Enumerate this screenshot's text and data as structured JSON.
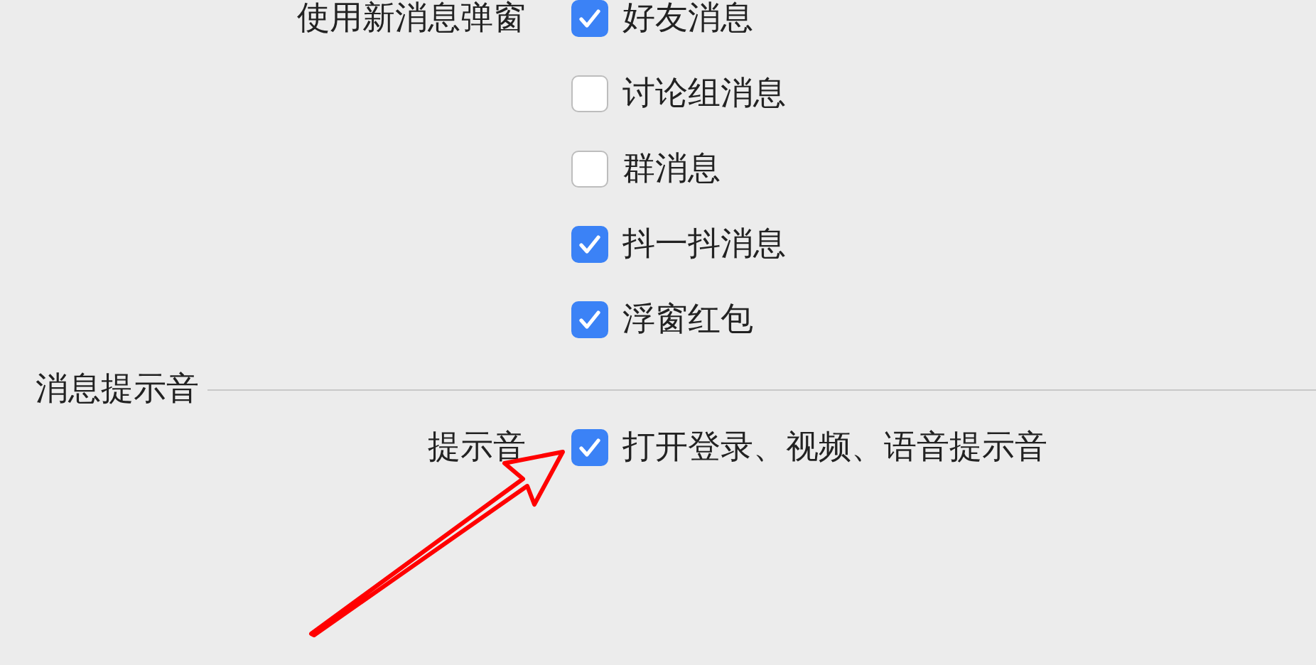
{
  "sections": [
    {
      "rows": [
        {
          "label": "使用新消息弹窗",
          "options": [
            {
              "text": "好友消息",
              "checked": true
            },
            {
              "text": "讨论组消息",
              "checked": false
            },
            {
              "text": "群消息",
              "checked": false
            },
            {
              "text": "抖一抖消息",
              "checked": true
            },
            {
              "text": "浮窗红包",
              "checked": true
            }
          ]
        }
      ]
    },
    {
      "title": "消息提示音",
      "rows": [
        {
          "label": "提示音",
          "options": [
            {
              "text": "打开登录、视频、语音提示音",
              "checked": true
            }
          ]
        }
      ]
    }
  ],
  "annotation": {
    "kind": "arrow"
  }
}
